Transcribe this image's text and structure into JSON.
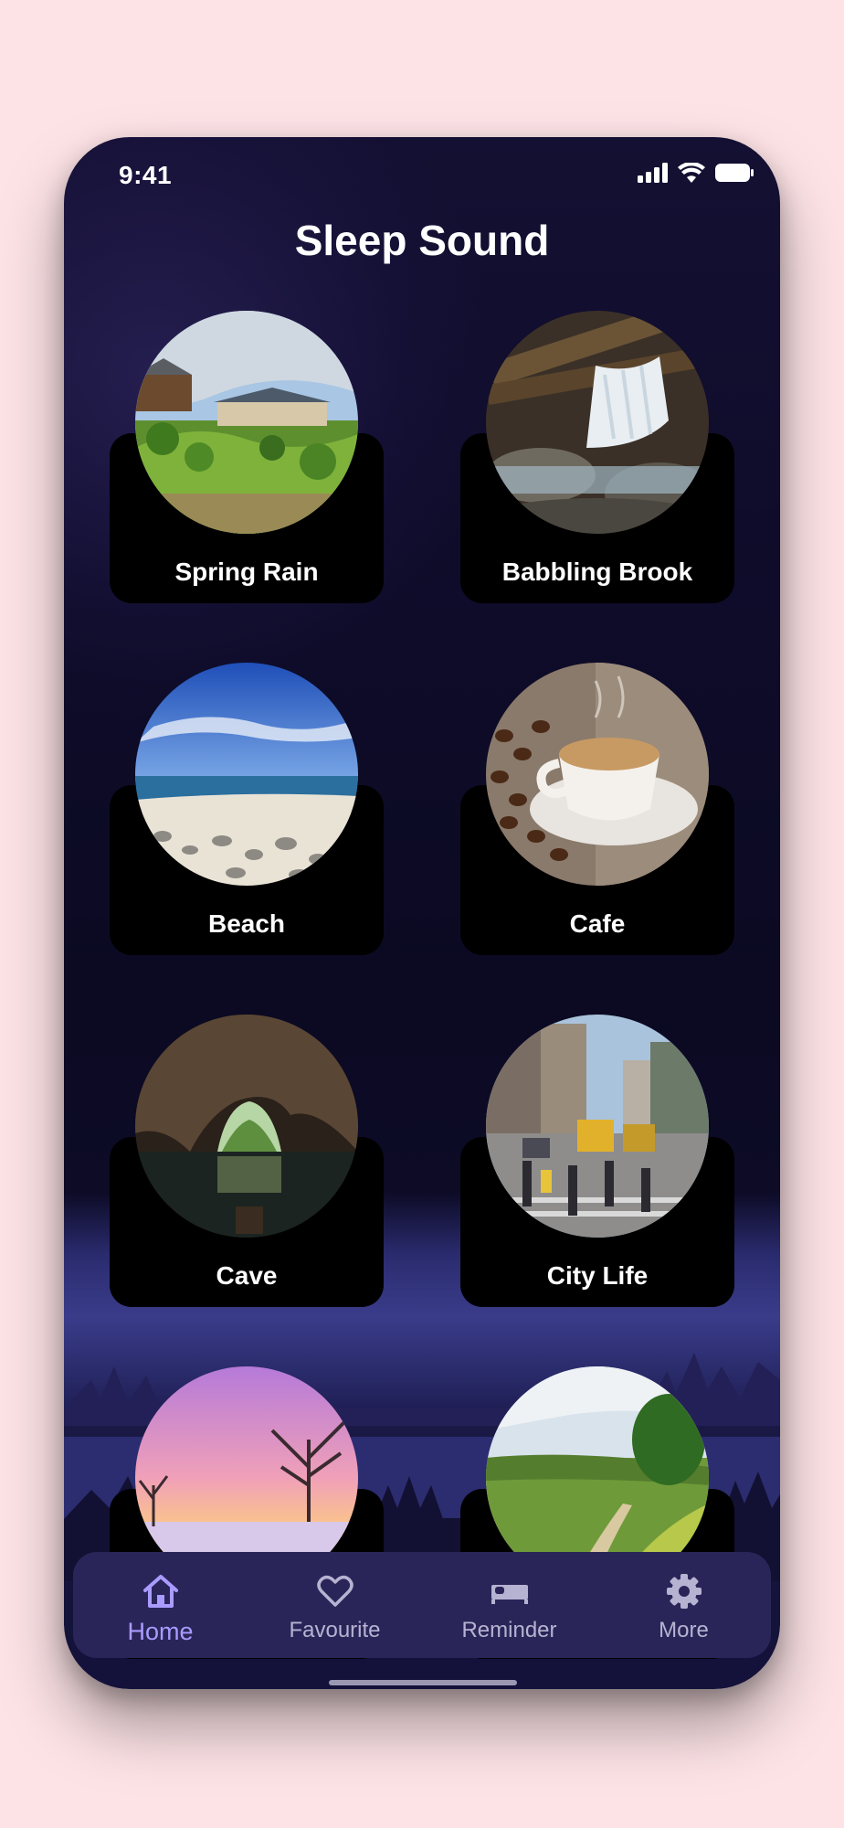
{
  "status": {
    "time": "9:41"
  },
  "header": {
    "title": "Sleep Sound"
  },
  "sounds": [
    {
      "label": "Spring Rain",
      "image": "house-on-hill"
    },
    {
      "label": "Babbling Brook",
      "image": "waterfall"
    },
    {
      "label": "Beach",
      "image": "pebble-beach"
    },
    {
      "label": "Cafe",
      "image": "coffee-cup"
    },
    {
      "label": "Cave",
      "image": "sea-cave"
    },
    {
      "label": "City Life",
      "image": "city-street"
    },
    {
      "label": "",
      "image": "winter-sunset"
    },
    {
      "label": "",
      "image": "countryside-path"
    }
  ],
  "nav": {
    "items": [
      {
        "label": "Home",
        "icon": "home-icon",
        "active": true
      },
      {
        "label": "Favourite",
        "icon": "heart-icon",
        "active": false
      },
      {
        "label": "Reminder",
        "icon": "bed-icon",
        "active": false
      },
      {
        "label": "More",
        "icon": "gear-icon",
        "active": false
      }
    ]
  },
  "colors": {
    "background": "#fde3e6",
    "screen": "#0f0c2b",
    "card": "#000000",
    "nav": "#2a2558",
    "accent": "#a99bff"
  }
}
